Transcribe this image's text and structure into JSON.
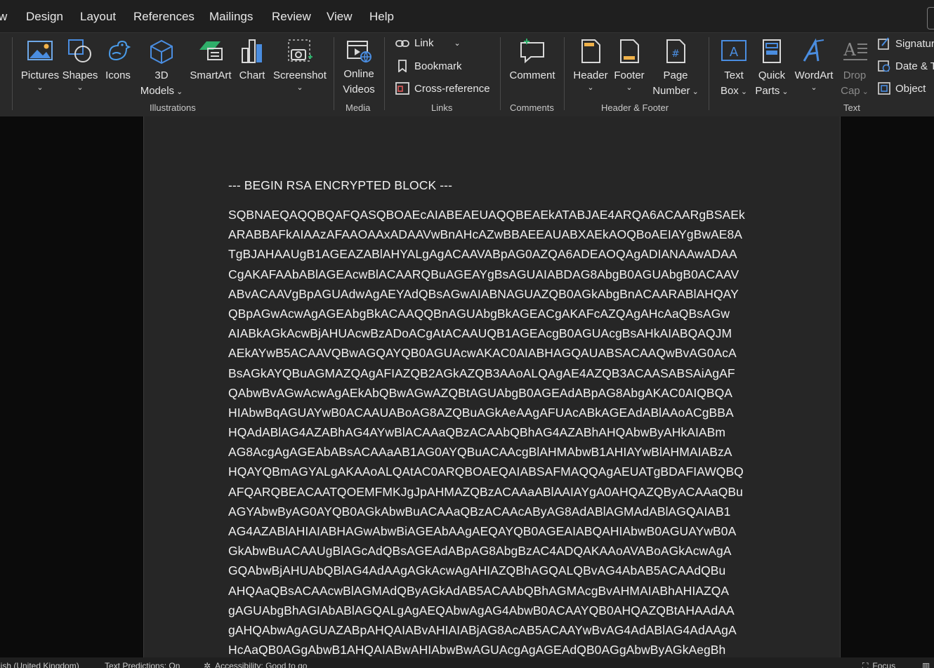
{
  "menu": {
    "tabs": [
      "w",
      "Design",
      "Layout",
      "References",
      "Mailings",
      "Review",
      "View",
      "Help"
    ]
  },
  "ribbon": {
    "illustrations": {
      "pictures": "Pictures",
      "shapes": "Shapes",
      "icons": "Icons",
      "models_line1": "3D",
      "models_line2": "Models",
      "smartart": "SmartArt",
      "chart": "Chart",
      "screenshot": "Screenshot",
      "group": "Illustrations"
    },
    "media": {
      "online_line1": "Online",
      "online_line2": "Videos",
      "group": "Media"
    },
    "links": {
      "link": "Link",
      "bookmark": "Bookmark",
      "crossref": "Cross-reference",
      "group": "Links"
    },
    "comments": {
      "comment": "Comment",
      "group": "Comments"
    },
    "header_footer": {
      "header": "Header",
      "footer": "Footer",
      "page_line1": "Page",
      "page_line2": "Number",
      "group": "Header & Footer"
    },
    "text": {
      "textbox_line1": "Text",
      "textbox_line2": "Box",
      "quick_line1": "Quick",
      "quick_line2": "Parts",
      "wordart": "WordArt",
      "drop_line1": "Drop",
      "drop_line2": "Cap",
      "signature": "Signatur",
      "datetime": "Date & T",
      "object": "Object",
      "group": "Text"
    }
  },
  "document": {
    "heading": "--- BEGIN RSA ENCRYPTED BLOCK ---",
    "lines": [
      "SQBNAEQAQQBQAFQASQBOAEcAIABEAEUAQQBEAEkATABJAE4ARQA6ACAARgBSAEk",
      "ARABBAFkAIAAzAFAAOAAxADAAVwBnAHcAZwBBAEEAUABXAEkAOQBoAEIAYgBwAE8A",
      "TgBJAHAAUgB1AGEAZABlAHYALgAgACAAVABpAG0AZQA6ADEAOQAgADIANAAwADAA",
      "CgAKAFAAbABlAGEAcwBlACAARQBuAGEAYgBsAGUAIABDAG8AbgB0AGUAbgB0ACAAV",
      "ABvACAAVgBpAGUAdwAgAEYAdQBsAGwAIABNAGUAZQB0AGkAbgBnACAARABlAHQAY",
      "QBpAGwAcwAgAGEAbgBkACAAQQBnAGUAbgBkAGEACgAKAFcAZQAgAHcAaQBsAGw",
      "AIABkAGkAcwBjAHUAcwBzADoACgAtACAAUQB1AGEAcgB0AGUAcgBsAHkAIABQAQJM",
      "AEkAYwB5ACAAVQBwAGQAYQB0AGUAcwAKAC0AIABHAGQAUABSACAAQwBvAG0AcA",
      "BsAGkAYQBuAGMAZQAgAFIAZQB2AGkAZQB3AAoALQAgAE4AZQB3ACAASABSAiAgAF",
      "QAbwBvAGwAcwAgAEkAbQBwAGwAZQBtAGUAbgB0AGEAdABpAG8AbgAKAC0AIQBQA",
      "HIAbwBqAGUAYwB0ACAAUABoAG8AZQBuAGkAeAAgAFUAcABkAGEAdABlAAoACgBBA",
      "HQAdABlAG4AZABhAG4AYwBlACAAaQBzACAAbQBhAG4AZABhAHQAbwByAHkAIABm",
      "AG8AcgAgAGEAbABsACAAaAB1AG0AYQBuACAAcgBlAHMAbwB1AHIAYwBlAHMAIABzA",
      "HQAYQBmAGYALgAKAAoALQAtAC0ARQBOAEQAIABSAFMAQQAgAEUATgBDAFIAWQBQ",
      "AFQARQBEACAATQOEMFMKJgJpAHMAZQBzACAAaABlAAIAYgA0AHQAZQByACAAaQBu",
      "AGYAbwByAG0AYQB0AGkAbwBuACAAaQBzACAAcAByAG8AdABlAGMAdABlAGQAIAB1",
      "AG4AZABlAHIAIABHAGwAbwBiAGEAbAAgAEQAYQB0AGEAIABQAHIAbwB0AGUAYwB0A",
      "GkAbwBuACAAUgBlAGcAdQBsAGEAdABpAG8AbgBzAC4ADQAKAAoAVABoAGkAcwAgA",
      "GQAbwBjAHUAbQBlAG4AdAAgAGkAcwAgAHIAZQBhAGQALQBvAG4AbAB5ACAAdQBu",
      "AHQAaQBsACAAcwBlAGMAdQByAGkAdAB5ACAAbQBhAGMAcgBvAHMAIABhAHIAZQA",
      "gAGUAbgBhAGIAbABlAGQALgAgAEQAbwAgAG4AbwB0ACAAYQB0AHQAZQBtAHAAdAA",
      "gAHQAbwAgAGUAZABpAHQAIABvAHIAIABjAG8AcAB5ACAAYwBvAG4AdABlAG4AdAAgA",
      "HcAaQB0AGgAbwB1AHQAIABwAHIAbwBwAGUAcgAgAGEAdQB0AGgAbwByAGkAegBh"
    ]
  },
  "status": {
    "language": "lish (United Kingdom)",
    "predictions": "Text Predictions: On",
    "accessibility": "Accessibility: Good to go",
    "focus": "Focus"
  }
}
